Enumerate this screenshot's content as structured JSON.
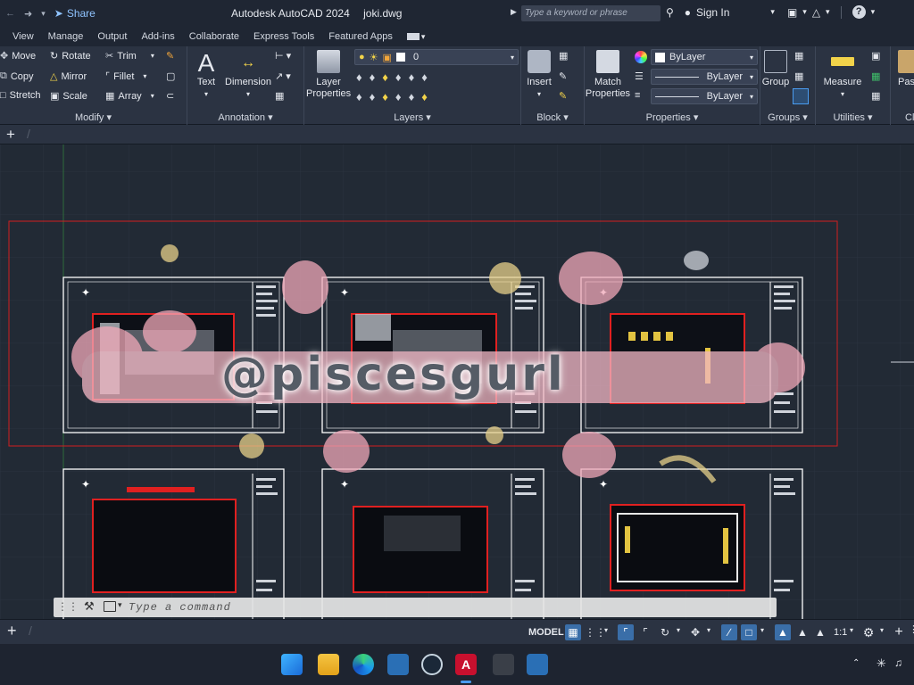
{
  "title": {
    "app": "Autodesk AutoCAD 2024",
    "file": "joki.dwg",
    "share": "Share"
  },
  "search": {
    "placeholder": "Type a keyword or phrase"
  },
  "account": {
    "sign_in": "Sign In"
  },
  "menu": [
    "View",
    "Manage",
    "Output",
    "Add-ins",
    "Collaborate",
    "Express Tools",
    "Featured Apps"
  ],
  "ribbon": {
    "modify": {
      "label": "Modify",
      "items": [
        "Move",
        "Rotate",
        "Trim",
        "Copy",
        "Mirror",
        "Fillet",
        "Stretch",
        "Scale",
        "Array"
      ]
    },
    "annotation": {
      "label": "Annotation",
      "text": "Text",
      "dimension": "Dimension"
    },
    "layers": {
      "label": "Layers",
      "layer_properties": [
        "Layer",
        "Properties"
      ],
      "current_layer": "0"
    },
    "block": {
      "label": "Block",
      "insert": "Insert"
    },
    "properties": {
      "label": "Properties",
      "match": [
        "Match",
        "Properties"
      ],
      "color": "ByLayer",
      "linetype": "ByLayer",
      "lineweight": "ByLayer"
    },
    "groups": {
      "label": "Groups",
      "group": "Group"
    },
    "utilities": {
      "label": "Utilities",
      "measure": "Measure"
    },
    "clipboard": {
      "label": "Cl",
      "paste": "Pas"
    }
  },
  "canvas": {
    "watermark": "@piscesgurl"
  },
  "command": {
    "placeholder": "Type a command"
  },
  "status": {
    "model": "MODEL",
    "scale": "1:1"
  },
  "colors": {
    "accent": "#4a9cf0",
    "frame": "#ffffff",
    "selection": "#d21f1f",
    "wall_red": "#e02020"
  }
}
